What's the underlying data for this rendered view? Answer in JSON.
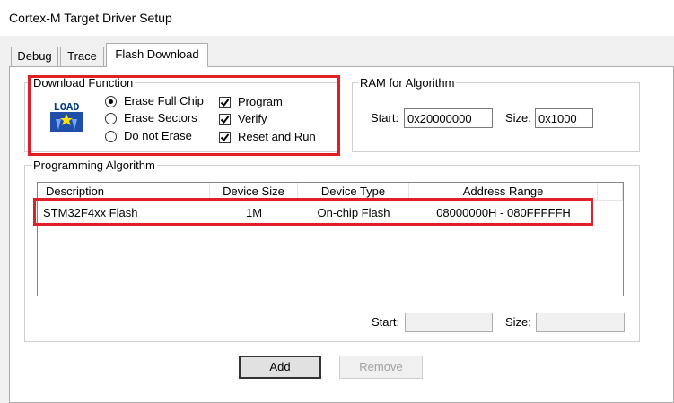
{
  "window": {
    "title": "Cortex-M Target Driver Setup"
  },
  "tabs": [
    {
      "label": "Debug"
    },
    {
      "label": "Trace"
    },
    {
      "label": "Flash Download",
      "active": true
    }
  ],
  "download_function": {
    "legend": "Download Function",
    "icon_text": "LOAD",
    "radios": [
      {
        "label": "Erase Full Chip",
        "selected": true
      },
      {
        "label": "Erase Sectors",
        "selected": false
      },
      {
        "label": "Do not Erase",
        "selected": false
      }
    ],
    "checkboxes": [
      {
        "label": "Program",
        "checked": true
      },
      {
        "label": "Verify",
        "checked": true
      },
      {
        "label": "Reset and Run",
        "checked": true
      }
    ]
  },
  "ram": {
    "legend": "RAM for Algorithm",
    "start_label": "Start:",
    "start_value": "0x20000000",
    "size_label": "Size:",
    "size_value": "0x1000"
  },
  "programming_algorithm": {
    "legend": "Programming Algorithm",
    "columns": [
      "Description",
      "Device Size",
      "Device Type",
      "Address Range"
    ],
    "rows": [
      {
        "description": "STM32F4xx Flash",
        "device_size": "1M",
        "device_type": "On-chip Flash",
        "address_range": "08000000H - 080FFFFFH"
      }
    ],
    "start_label": "Start:",
    "start_value": "",
    "size_label": "Size:",
    "size_value": ""
  },
  "buttons": {
    "add": "Add",
    "remove": "Remove"
  },
  "colors": {
    "highlight": "#e01f26",
    "dialog_bg": "#f0f0f0",
    "panel_bg": "#ffffff"
  }
}
